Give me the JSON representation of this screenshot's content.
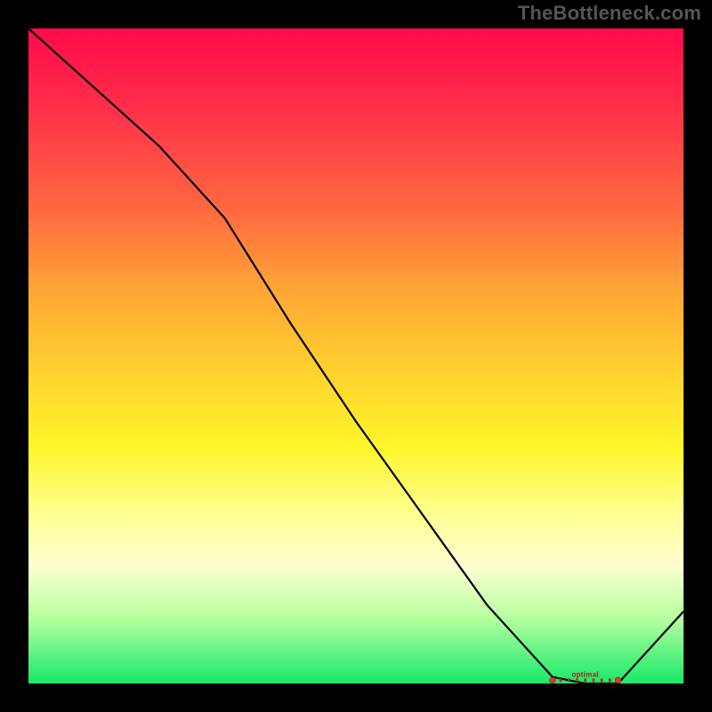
{
  "watermark": "TheBottleneck.com",
  "chart_data": {
    "type": "line",
    "title": "",
    "xlabel": "",
    "ylabel": "",
    "x": [
      0.0,
      0.1,
      0.2,
      0.3,
      0.4,
      0.5,
      0.6,
      0.7,
      0.8,
      0.85,
      0.9,
      1.0
    ],
    "values": [
      1.0,
      0.91,
      0.82,
      0.71,
      0.55,
      0.4,
      0.26,
      0.12,
      0.01,
      0.0,
      0.0,
      0.11
    ],
    "xlim": [
      0,
      1
    ],
    "ylim": [
      0,
      1
    ],
    "markers": {
      "x_range": [
        0.8,
        0.9
      ],
      "y": 0.005,
      "label": "optimal"
    },
    "background_gradient": {
      "top": "#ff0a4a",
      "middle": "#fff62a",
      "bottom": "#18e86a"
    }
  }
}
